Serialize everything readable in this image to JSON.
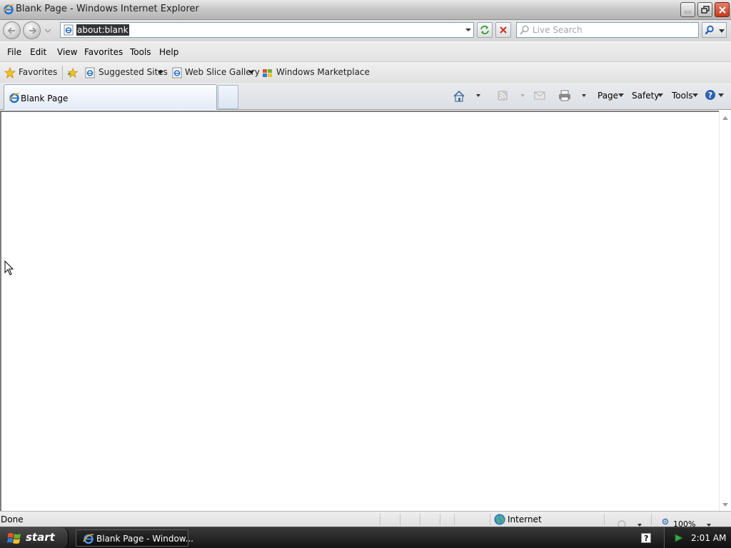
{
  "window": {
    "title": "Blank Page - Windows Internet Explorer",
    "icon": "ie-icon"
  },
  "address_bar": {
    "url": "about:blank",
    "page_icon": "ie-page-icon"
  },
  "search": {
    "placeholder": "Live Search"
  },
  "menu": {
    "items": [
      "File",
      "Edit",
      "View",
      "Favorites",
      "Tools",
      "Help"
    ]
  },
  "favorites_bar": {
    "favorites_label": "Favorites",
    "items": [
      {
        "label": "Suggested Sites",
        "icon": "ie-page-icon",
        "has_dropdown": true
      },
      {
        "label": "Web Slice Gallery",
        "icon": "ie-page-icon",
        "has_dropdown": true
      },
      {
        "label": "Windows Marketplace",
        "icon": "marketplace-icon",
        "has_dropdown": false
      }
    ]
  },
  "tabs": {
    "active_tab_label": "Blank Page"
  },
  "command_bar": {
    "page_label": "Page",
    "safety_label": "Safety",
    "tools_label": "Tools",
    "icons": [
      "home-icon",
      "feeds-icon",
      "mail-icon",
      "print-icon",
      "help-icon"
    ]
  },
  "status_bar": {
    "status": "Done",
    "zone": "Internet",
    "zoom": "100%"
  },
  "taskbar": {
    "start_label": "start",
    "task_label": "Blank Page - Window...",
    "clock": "2:01 AM"
  },
  "colors": {
    "ie_blue": "#1f6fd0",
    "close_red": "#c4391e",
    "selection": "#333333"
  }
}
